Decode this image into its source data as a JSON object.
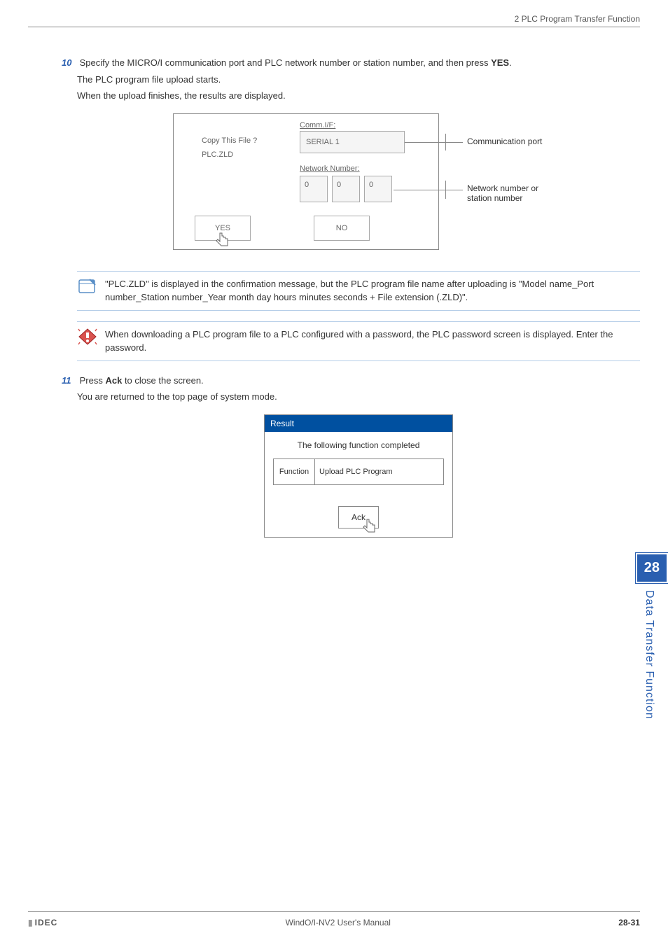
{
  "header": {
    "section": "2 PLC Program Transfer Function"
  },
  "step10": {
    "number": "10",
    "line1_a": "Specify the MICRO/I communication port and PLC network number or station number, and then press ",
    "line1_b": "YES",
    "line1_c": ".",
    "line2": "The PLC program file upload starts.",
    "line3": "When the upload finishes, the results are displayed."
  },
  "dialog1": {
    "comm_label": "Comm.I/F:",
    "copy_this": "Copy This File ?",
    "plc_zld": "PLC.ZLD",
    "serial": "SERIAL  1",
    "network_label": "Network Number:",
    "num1": "0",
    "num2": "0",
    "num3": "0",
    "yes": "YES",
    "no": "NO",
    "callout_comm": "Communication port",
    "callout_net1": "Network number or",
    "callout_net2": "station number"
  },
  "note1": {
    "text": "\"PLC.ZLD\" is displayed in the confirmation message, but the PLC program file name after uploading is \"Model name_Port number_Station number_Year month day hours minutes seconds + File extension (.ZLD)\"."
  },
  "note2": {
    "text": "When downloading a PLC program file to a PLC configured with a password, the PLC password screen is displayed. Enter the password."
  },
  "step11": {
    "number": "11",
    "line1_a": "Press ",
    "line1_b": "Ack",
    "line1_c": " to close the screen.",
    "line2": "You are returned to the top page of system mode."
  },
  "dialog2": {
    "title": "Result",
    "message": "The following function completed",
    "func_label": "Function",
    "func_value": "Upload PLC Program",
    "ack": "Ack"
  },
  "sidetab": {
    "number": "28",
    "label": "Data Transfer Function"
  },
  "footer": {
    "logo": "IDEC",
    "center": "WindO/I-NV2 User's Manual",
    "page": "28-31"
  }
}
